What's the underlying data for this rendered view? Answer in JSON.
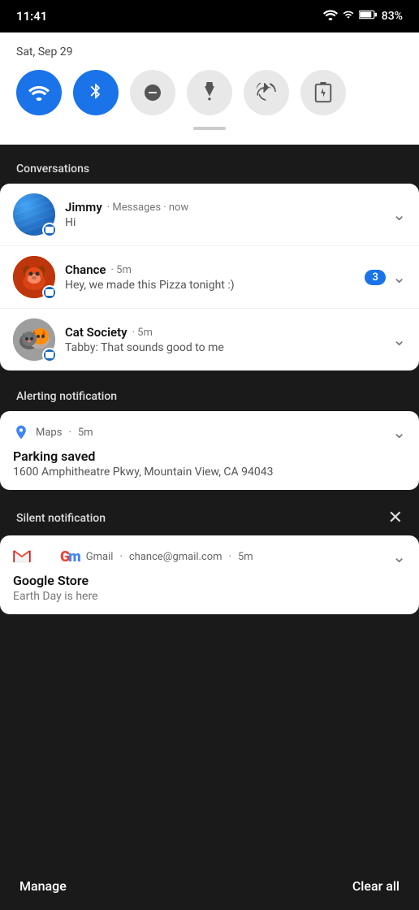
{
  "statusBar": {
    "time": "11:41",
    "battery": "83%"
  },
  "quickSettings": {
    "date": "Sat, Sep 29",
    "buttons": [
      {
        "id": "wifi",
        "label": "Wi-Fi",
        "active": true,
        "icon": "wifi"
      },
      {
        "id": "bluetooth",
        "label": "Bluetooth",
        "active": true,
        "icon": "bluetooth"
      },
      {
        "id": "dnd",
        "label": "Do Not Disturb",
        "active": false,
        "icon": "dnd"
      },
      {
        "id": "flashlight",
        "label": "Flashlight",
        "active": false,
        "icon": "flash"
      },
      {
        "id": "rotate",
        "label": "Auto-rotate",
        "active": false,
        "icon": "rotate"
      },
      {
        "id": "battery-saver",
        "label": "Battery Saver",
        "active": false,
        "icon": "battery"
      }
    ]
  },
  "sections": {
    "conversations": "Conversations",
    "alerting": "Alerting notification",
    "silent": "Silent notification"
  },
  "conversations": [
    {
      "id": "jimmy",
      "name": "Jimmy",
      "app": "Messages",
      "time": "now",
      "message": "Hi",
      "badge": null,
      "avatarStyle": "jimmy"
    },
    {
      "id": "chance",
      "name": "Chance",
      "app": "",
      "time": "5m",
      "message": "Hey, we made this Pizza tonight :)",
      "badge": "3",
      "avatarStyle": "chance"
    },
    {
      "id": "cat-society",
      "name": "Cat Society",
      "app": "",
      "time": "5m",
      "message": "Tabby: That sounds good to me",
      "badge": null,
      "avatarStyle": "cat"
    }
  ],
  "alertingNotification": {
    "app": "Maps",
    "time": "5m",
    "title": "Parking saved",
    "body": "1600 Amphitheatre Pkwy, Mountain View, CA 94043"
  },
  "silentNotification": {
    "gmail": {
      "app": "Gmail",
      "sender": "chance@gmail.com",
      "time": "5m",
      "title": "Google Store",
      "body": "Earth Day is here"
    }
  },
  "bottomBar": {
    "manage": "Manage",
    "clearAll": "Clear all"
  }
}
